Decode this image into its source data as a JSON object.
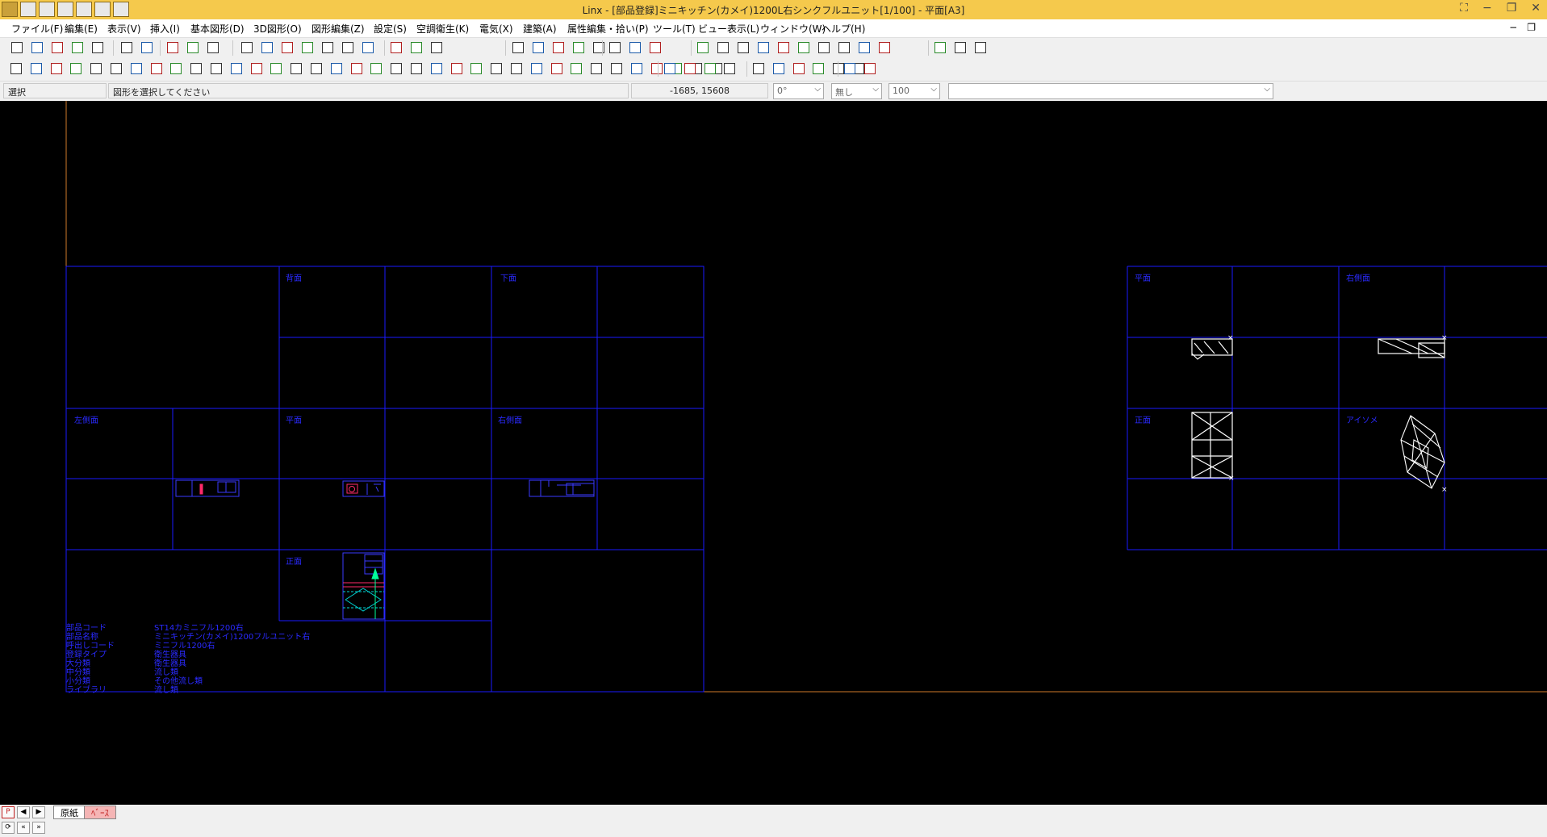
{
  "window": {
    "title": "Linx - [部品登録]ミニキッチン(カメイ)1200L右シンクフルユニット[1/100] - 平面[A3]"
  },
  "menu": [
    "ファイル(F)",
    "編集(E)",
    "表示(V)",
    "挿入(I)",
    "基本図形(D)",
    "3D図形(O)",
    "図形編集(Z)",
    "設定(S)",
    "空調衛生(K)",
    "電気(X)",
    "建築(A)",
    "属性編集・拾い(P)",
    "ツール(T)",
    "ビュー表示(L)",
    "ウィンドウ(W)",
    "ヘルプ(H)"
  ],
  "status": {
    "mode": "選択",
    "message": "図形を選択してください",
    "coords": "-1685, 15608",
    "angle": "0°",
    "linetype": "無し",
    "scale": "100",
    "layer": ""
  },
  "drawing": {
    "left_panel_labels": [
      "背面",
      "下面",
      "左側面",
      "平面",
      "右側面",
      "正面"
    ],
    "right_panel_labels": [
      "平面",
      "右側面",
      "正面",
      "アイソメ"
    ],
    "properties": [
      {
        "key": "部品コード",
        "value": "ST14カミニフル1200右"
      },
      {
        "key": "部品名称",
        "value": "ミニキッチン(カメイ)1200フルユニット右"
      },
      {
        "key": "呼出しコード",
        "value": "ミニフル1200右"
      },
      {
        "key": "登録タイプ",
        "value": "衛生器具"
      },
      {
        "key": "大分類",
        "value": "衛生器具"
      },
      {
        "key": "中分類",
        "value": "流し類"
      },
      {
        "key": "小分類",
        "value": "その他流し類"
      },
      {
        "key": "ライブラリ",
        "value": "流し類"
      }
    ]
  },
  "tabs": [
    {
      "label": "原紙",
      "active": true
    },
    {
      "label": "ﾍﾞｰｽ",
      "active": false
    }
  ],
  "colors": {
    "titlebar": "#f5c94c",
    "canvas": "#000000",
    "frame": "#1a1aff",
    "cad_label": "#2a2aff",
    "border_line": "#d07a2a",
    "tab_active": "#ffffff",
    "tab_inactive": "#f5b5b5"
  }
}
